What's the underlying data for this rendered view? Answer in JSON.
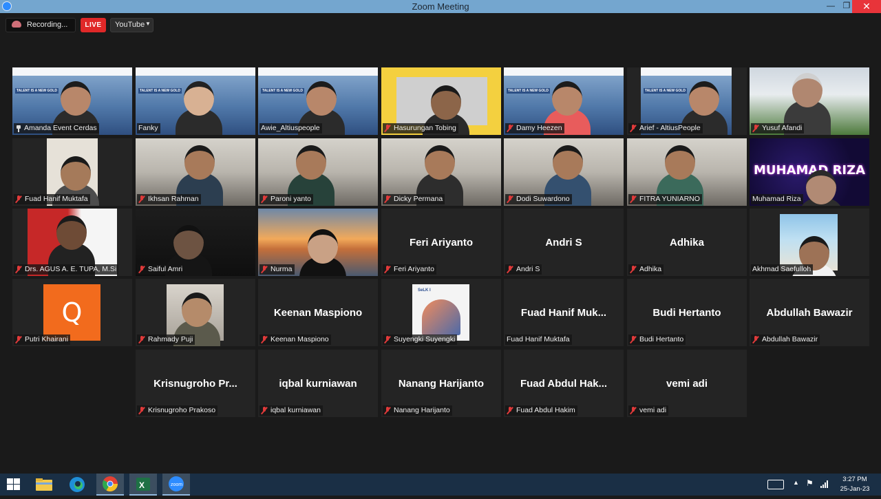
{
  "window": {
    "title": "Zoom Meeting",
    "minimize": "—",
    "maximize": "❐",
    "close": "✕"
  },
  "topbar": {
    "recording_label": "Recording...",
    "live_badge": "LIVE",
    "stream_target": "YouTube"
  },
  "participants": [
    {
      "name": "Amanda Event Cerdas",
      "label": "",
      "video": true,
      "muted": false,
      "pinned": true
    },
    {
      "name": "Fanky",
      "label": "",
      "video": true,
      "muted": false
    },
    {
      "name": "Awie_Altiuspeople",
      "label": "",
      "video": true,
      "muted": false
    },
    {
      "name": "Hasurungan Tobing",
      "label": "",
      "video": true,
      "muted": true
    },
    {
      "name": "Damy Heezen",
      "label": "",
      "video": true,
      "muted": true
    },
    {
      "name": "Arief - AltiusPeople",
      "label": "",
      "video": true,
      "muted": true
    },
    {
      "name": "Yusuf Afandi",
      "label": "",
      "video": true,
      "muted": true
    },
    {
      "name": "Fuad Hanif Muktafa",
      "label": "",
      "video": true,
      "muted": true
    },
    {
      "name": "Ikhsan Rahman",
      "label": "",
      "video": true,
      "muted": true
    },
    {
      "name": "Paroni yanto",
      "label": "",
      "video": true,
      "muted": true
    },
    {
      "name": "Dicky Permana",
      "label": "",
      "video": true,
      "muted": true
    },
    {
      "name": "Dodi Suwardono",
      "label": "",
      "video": true,
      "muted": true
    },
    {
      "name": "FITRA YUNIARNO",
      "label": "",
      "video": true,
      "muted": true
    },
    {
      "name": "Muhamad Riza",
      "label": "MUHAMAD RIZA",
      "video": true,
      "muted": false
    },
    {
      "name": "Drs. AGUS A. E. TUPA, M.Si",
      "label": "",
      "video": true,
      "muted": true
    },
    {
      "name": "Saiful Amri",
      "label": "",
      "video": true,
      "muted": true
    },
    {
      "name": "Nurma",
      "label": "",
      "video": true,
      "muted": true
    },
    {
      "name": "Feri Ariyanto",
      "label": "Feri Ariyanto",
      "video": false,
      "muted": true
    },
    {
      "name": "Andri S",
      "label": "Andri S",
      "video": false,
      "muted": true
    },
    {
      "name": "Adhika",
      "label": "Adhika",
      "video": false,
      "muted": true
    },
    {
      "name": "Akhmad Saefulloh",
      "label": "",
      "video": true,
      "muted": false
    },
    {
      "name": "Putri Khairani",
      "label": "Q",
      "video": true,
      "muted": true
    },
    {
      "name": "Rahmady Puji",
      "label": "",
      "video": true,
      "muted": true
    },
    {
      "name": "Keenan Maspiono",
      "label": "Keenan Maspiono",
      "video": false,
      "muted": true
    },
    {
      "name": "Suyengki Suyengki",
      "label": "SeLK I",
      "video": true,
      "muted": true
    },
    {
      "name": "Fuad Hanif Muktafa",
      "label": "Fuad Hanif Muk...",
      "video": false,
      "muted": false
    },
    {
      "name": "Budi Hertanto",
      "label": "Budi Hertanto",
      "video": false,
      "muted": true
    },
    {
      "name": "Abdullah Bawazir",
      "label": "Abdullah Bawazir",
      "video": false,
      "muted": true
    },
    {
      "name": "Krisnugroho Prakoso",
      "label": "Krisnugroho Pr...",
      "video": false,
      "muted": true
    },
    {
      "name": "iqbal kurniawan",
      "label": "iqbal kurniawan",
      "video": false,
      "muted": true
    },
    {
      "name": "Nanang Harijanto",
      "label": "Nanang Harijanto",
      "video": false,
      "muted": true
    },
    {
      "name": "Fuad Abdul Hakim",
      "label": "Fuad Abdul Hak...",
      "video": false,
      "muted": true
    },
    {
      "name": "vemi adi",
      "label": "vemi adi",
      "video": false,
      "muted": true
    }
  ],
  "banner_text": "TALENT IS A NEW GOLD",
  "taskbar": {
    "time": "3:27 PM",
    "date": "25-Jan-23",
    "apps": [
      "windows-start",
      "file-explorer",
      "edge",
      "chrome",
      "excel",
      "zoom"
    ]
  },
  "colors": {
    "active_speaker": "#e7e873",
    "live": "#e02828",
    "muted_icon": "#e03a3a"
  }
}
